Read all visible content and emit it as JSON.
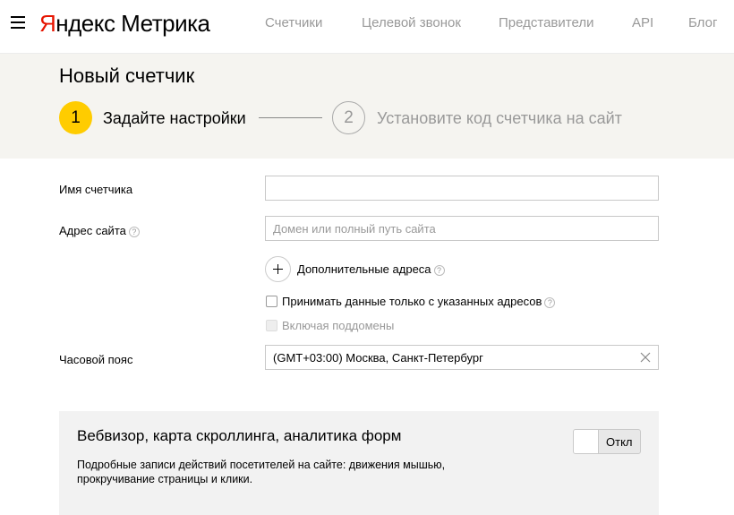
{
  "header": {
    "logo_ya": "Я",
    "logo_rest": "ндекс",
    "logo_product": "Метрика",
    "nav": [
      "Счетчики",
      "Целевой звонок",
      "Представители",
      "API",
      "Блог"
    ]
  },
  "page": {
    "title": "Новый счетчик",
    "steps": [
      {
        "number": "1",
        "label": "Задайте настройки",
        "active": true
      },
      {
        "number": "2",
        "label": "Установите код счетчика на сайт",
        "active": false
      }
    ]
  },
  "form": {
    "name_label": "Имя счетчика",
    "name_value": "",
    "address_label": "Адрес сайта",
    "address_placeholder": "Домен или полный путь сайта",
    "help_glyph": "?",
    "extra_addresses_label": "Дополнительные адреса",
    "only_specified_label": "Принимать данные только с указанных адресов",
    "only_specified_checked": false,
    "include_subdomains_label": "Включая поддомены",
    "include_subdomains_checked": false,
    "include_subdomains_disabled": true,
    "timezone_label": "Часовой пояс",
    "timezone_value": "(GMT+03:00) Москва, Санкт-Петербург"
  },
  "webvisor": {
    "title": "Вебвизор, карта скроллинга, аналитика форм",
    "description": "Подробные записи действий посетителей на сайте: движения мышью, прокручивание страницы и клики.",
    "toggle_label": "Откл",
    "enabled": false
  },
  "colors": {
    "brand_red": "#e61400",
    "accent_yellow": "#ffcc00",
    "band_bg": "#f5f4f0",
    "card_bg": "#f2f2f2"
  }
}
